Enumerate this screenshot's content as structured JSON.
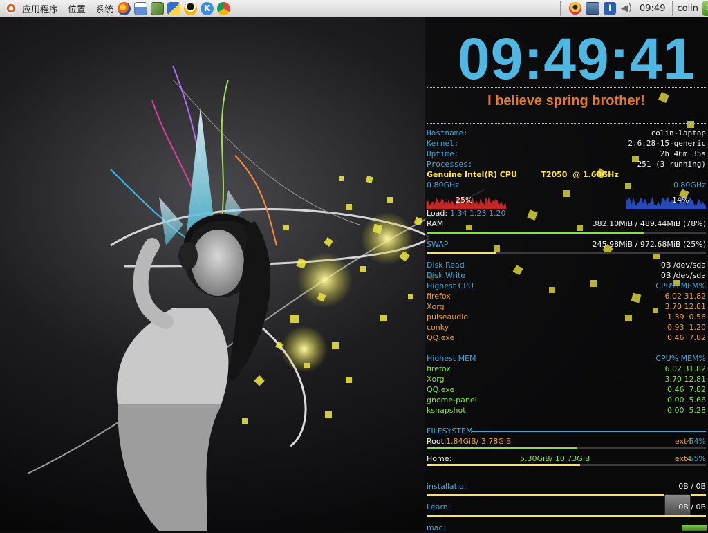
{
  "panel": {
    "menus": [
      "应用程序",
      "位置",
      "系统"
    ],
    "launchers": [
      "firefox-icon",
      "desktop-icon",
      "books-icon",
      "mail-icon",
      "qq-icon",
      "kde-k-icon",
      "chrome-icon"
    ],
    "tray": [
      "qq-status-icon",
      "network-icon",
      "info-icon",
      "volume-icon"
    ],
    "time": "09:49",
    "user": "colin",
    "logout": "power-icon"
  },
  "conky": {
    "clock": "09:49:41",
    "slogan": "I believe spring brother!",
    "sys": [
      {
        "label": "Hostname:",
        "value": "colin-laptop"
      },
      {
        "label": "Kernel:",
        "value": "2.6.28-15-generic"
      },
      {
        "label": "Uptime:",
        "value": "2h 46m 35s"
      },
      {
        "label": "Processes:",
        "value": "251 (3 running)"
      }
    ],
    "cpu": {
      "model": "Genuine Intel(R) CPU         T2050  @ 1.60GHz",
      "freq1": "0.80GHz",
      "freq2": "0.80GHz",
      "usage1": "25%",
      "usage2": "14%",
      "load_label": "Load:",
      "load": "1.34 1.23 1.20"
    },
    "ram": {
      "label": "RAM",
      "value": "382.10MiB / 489.44MiB (78%)",
      "percent": 78
    },
    "swap": {
      "label": "SWAP",
      "value": "245.98MiB / 972.68MiB (25%)",
      "percent": 25
    },
    "disk": {
      "read_label": "Disk Read",
      "read_value": "0B /dev/sda",
      "write_label": "Disk Write",
      "write_value": "0B /dev/sda"
    },
    "top_cpu": {
      "title": "Highest CPU",
      "header": "CPU% MEM%",
      "rows": [
        {
          "name": "firefox",
          "value": "6.02 31.82"
        },
        {
          "name": "Xorg",
          "value": "3.70 12.81"
        },
        {
          "name": "pulseaudio",
          "value": "1.39  0.56"
        },
        {
          "name": "conky",
          "value": "0.93  1.20"
        },
        {
          "name": "QQ.exe",
          "value": "0.46  7.82"
        }
      ]
    },
    "top_mem": {
      "title": "Highest MEM",
      "header": "CPU% MEM%",
      "rows": [
        {
          "name": "firefox",
          "value": "6.02 31.82"
        },
        {
          "name": "Xorg",
          "value": "3.70 12.81"
        },
        {
          "name": "QQ.exe",
          "value": "0.46  7.82"
        },
        {
          "name": "gnome-panel",
          "value": "0.00  5.66"
        },
        {
          "name": "ksnapshot",
          "value": "0.00  5.28"
        }
      ]
    },
    "fs": {
      "title": "FILESYSTEM",
      "root": {
        "label": "Root:",
        "value": "1.84GiB/ 3.78GiB",
        "type": "ext4",
        "pct": "54%",
        "percent": 54
      },
      "home": {
        "label": "Home:",
        "value": "5.30GiB/ 10.73GiB",
        "type": "ext4",
        "pct": "55%",
        "percent": 55
      },
      "mounts": [
        {
          "name": "installatio:",
          "value": "0B / 0B"
        },
        {
          "name": "Learn:",
          "value": "0B / 0B"
        },
        {
          "name": "mac:",
          "value": ""
        }
      ]
    }
  },
  "colors": {
    "cyan": "#3fa6d6",
    "yellow": "#ffe34d",
    "orange": "#e47a2e",
    "green": "#86e243",
    "cpu_graph1": "#c42525",
    "cpu_graph2": "#2749b5"
  }
}
